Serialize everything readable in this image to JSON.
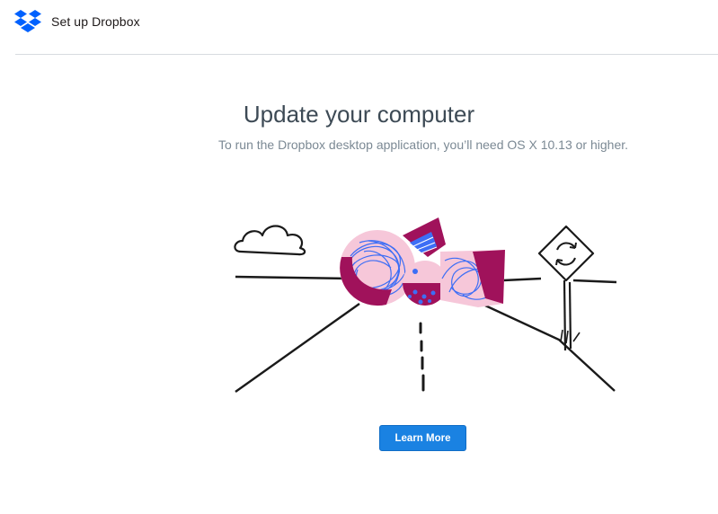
{
  "header": {
    "logo_icon": "dropbox-logo-icon",
    "title": "Set up Dropbox"
  },
  "main": {
    "headline": "Update your computer",
    "subtext": "To run the Dropbox desktop application, you’ll need OS X 10.13 or higher.",
    "illustration_icon": "road-update-illustration",
    "learn_more_label": "Learn More"
  },
  "colors": {
    "brand_blue": "#0061FE",
    "button_blue": "#1a82e2",
    "accent_magenta": "#a0125b",
    "accent_pink": "#f6c7d9",
    "scribble_blue": "#3d6ef5"
  }
}
